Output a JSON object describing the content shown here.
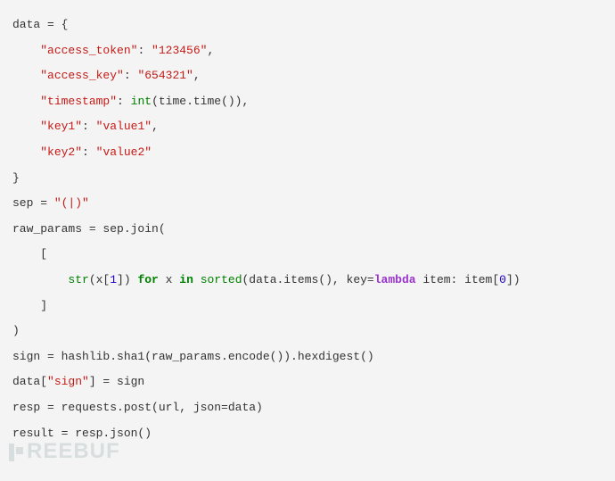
{
  "code": {
    "l1_a": "data = {",
    "l2_a": "    ",
    "l2_b": "\"access_token\"",
    "l2_c": ": ",
    "l2_d": "\"123456\"",
    "l2_e": ",",
    "l3_a": "    ",
    "l3_b": "\"access_key\"",
    "l3_c": ": ",
    "l3_d": "\"654321\"",
    "l3_e": ",",
    "l4_a": "    ",
    "l4_b": "\"timestamp\"",
    "l4_c": ": ",
    "l4_d": "int",
    "l4_e": "(time.time()),",
    "l5_a": "    ",
    "l5_b": "\"key1\"",
    "l5_c": ": ",
    "l5_d": "\"value1\"",
    "l5_e": ",",
    "l6_a": "    ",
    "l6_b": "\"key2\"",
    "l6_c": ": ",
    "l6_d": "\"value2\"",
    "l7_a": "}",
    "l8_a": "sep = ",
    "l8_b": "\"(|)\"",
    "l9_a": "raw_params = sep.join(",
    "l10_a": "    [",
    "l11_a": "        ",
    "l11_b": "str",
    "l11_c": "(x[",
    "l11_d": "1",
    "l11_e": "]) ",
    "l11_f": "for",
    "l11_g": " x ",
    "l11_h": "in",
    "l11_i": " ",
    "l11_j": "sorted",
    "l11_k": "(data.items(), key=",
    "l11_l": "lambda",
    "l11_m": " item: item[",
    "l11_n": "0",
    "l11_o": "])",
    "l12_a": "    ]",
    "l13_a": ")",
    "l14_a": "sign = hashlib.sha1(raw_params.encode()).hexdigest()",
    "l15_a": "data[",
    "l15_b": "\"sign\"",
    "l15_c": "] = sign",
    "l16_a": "resp = requests.post(url, json=data)",
    "l17_a": "result = resp.json()"
  },
  "watermark_text": "REEBUF"
}
